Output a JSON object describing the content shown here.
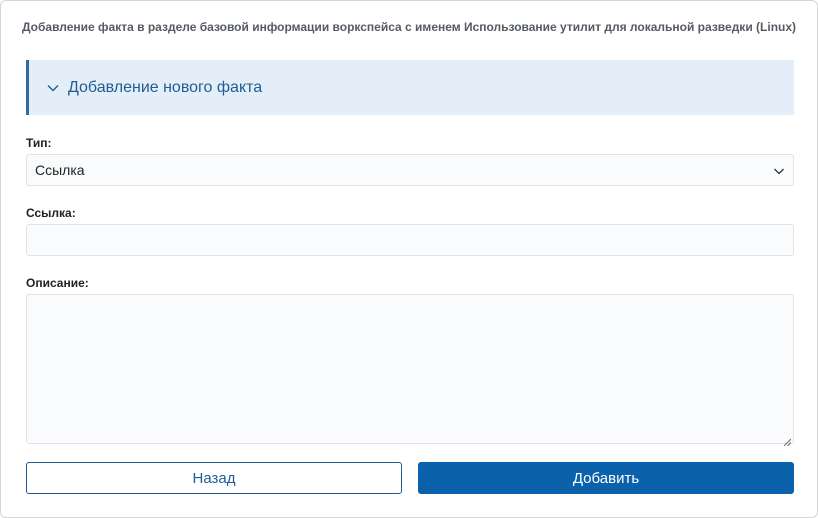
{
  "page": {
    "title": "Добавление факта в разделе базовой информации воркспейса с именем Использование утилит для локальной разведки (Linux)"
  },
  "section": {
    "title": "Добавление нового факта",
    "icon": "chevron-down-icon"
  },
  "form": {
    "type": {
      "label": "Тип:",
      "value": "Ссылка",
      "icon": "chevron-down-icon"
    },
    "link": {
      "label": "Ссылка:",
      "value": ""
    },
    "description": {
      "label": "Описание:",
      "value": ""
    }
  },
  "buttons": {
    "back": "Назад",
    "add": "Добавить"
  },
  "colors": {
    "accent": "#0b62ab",
    "header_bg": "#e4eef8",
    "header_text": "#1f5c93"
  }
}
